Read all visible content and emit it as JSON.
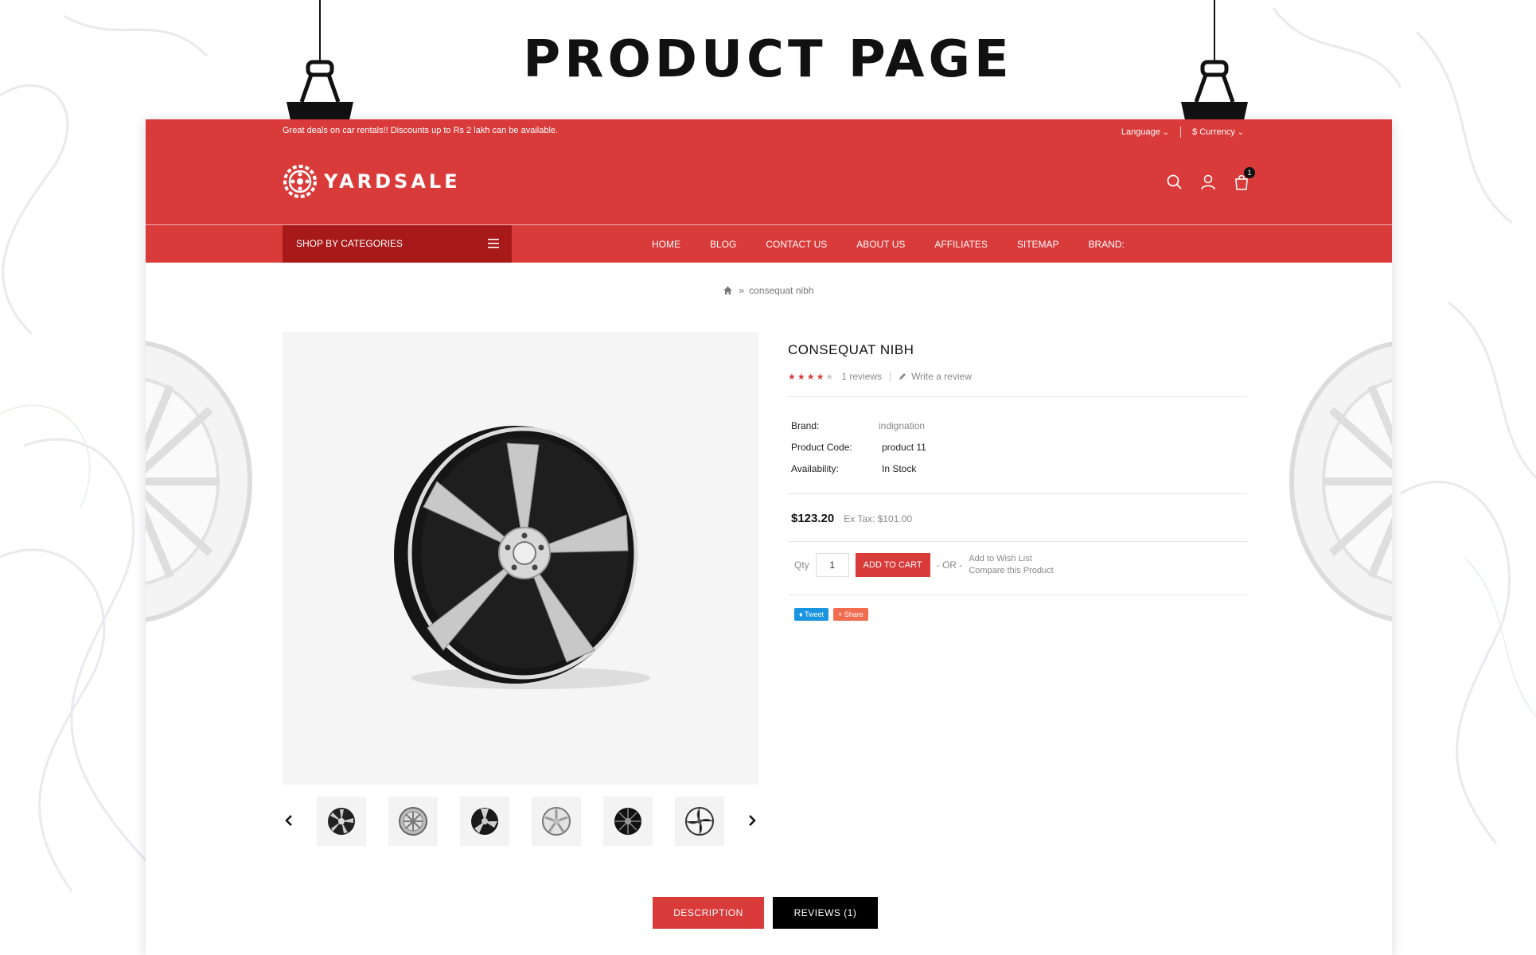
{
  "showcase": {
    "title": "PRODUCT PAGE"
  },
  "topbar": {
    "promo": "Great deals on car rentals!! Discounts up to Rs 2 lakh can be available.",
    "language": "Language",
    "currency": "$ Currency"
  },
  "brand": {
    "name": "YARDSALE"
  },
  "header": {
    "cart_count": "1"
  },
  "nav": {
    "shop_categories": "SHOP BY CATEGORIES",
    "links": [
      "HOME",
      "BLOG",
      "CONTACT US",
      "ABOUT US",
      "AFFILIATES",
      "SITEMAP",
      "BRAND:"
    ]
  },
  "breadcrumb": {
    "sep": "»",
    "current": "consequat nibh"
  },
  "product": {
    "title": "CONSEQUAT NIBH",
    "rating": 4,
    "rating_max": 5,
    "reviews_link": "1 reviews",
    "write_review": "Write a review",
    "specs": [
      {
        "label": "Brand:",
        "value": "indignation"
      },
      {
        "label": "Product Code:",
        "value": "product 11"
      },
      {
        "label": "Availability:",
        "value": "In Stock"
      }
    ],
    "price": "$123.20",
    "ex_tax": "Ex Tax: $101.00",
    "qty_label": "Qty",
    "qty_value": "1",
    "add_to_cart": "ADD TO CART",
    "or_label": "- OR -",
    "wishlist": "Add to Wish List",
    "compare": "Compare this Product",
    "tweet": "Tweet",
    "share": "Share"
  },
  "tabs": {
    "description": "DESCRIPTION",
    "reviews": "REVIEWS (1)"
  },
  "colors": {
    "primary": "#d93a3a",
    "dark_red": "#a81919",
    "black": "#000000",
    "twitter": "#1b95e0",
    "share": "#f26c4f"
  }
}
